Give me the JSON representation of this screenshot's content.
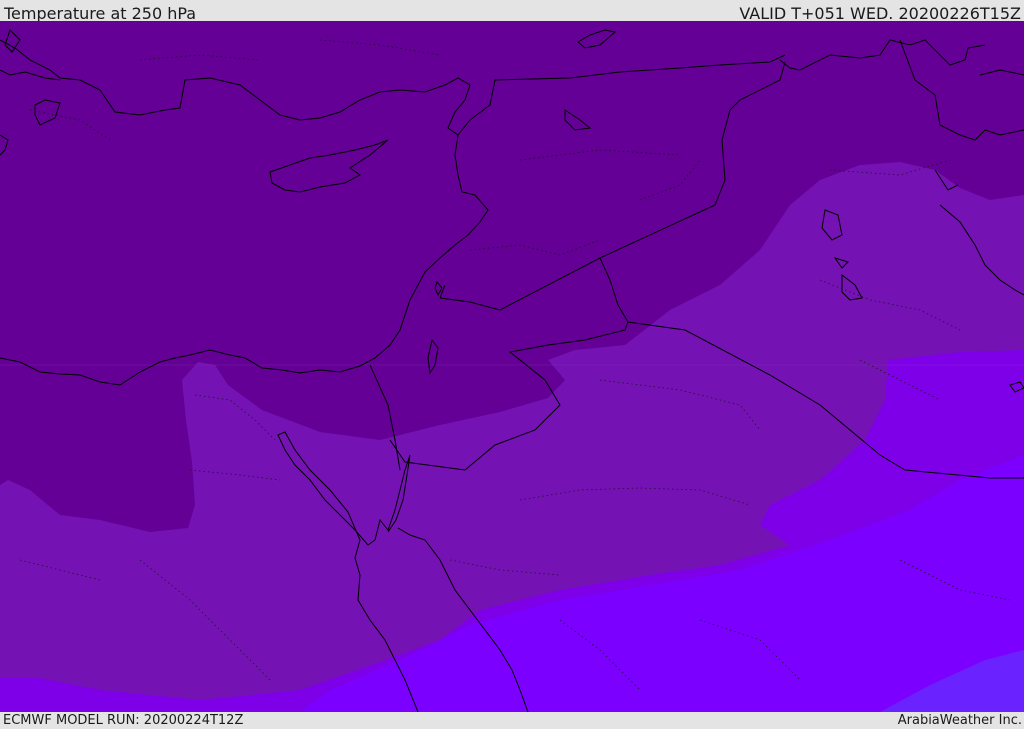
{
  "header": {
    "title": "Temperature at 250 hPa",
    "valid_time": "VALID T+051 WED. 20200226T15Z"
  },
  "footer": {
    "model_run": "ECMWF MODEL RUN: 20200224T12Z",
    "credit": "ArabiaWeather Inc."
  },
  "map": {
    "variable": "temperature",
    "level": "250 hPa",
    "colors": {
      "coldest": "#640095",
      "cold": "#7412b3",
      "mild": "#7d00e6",
      "warm": "#7b00ff",
      "warmest": "#6a1eff",
      "coastline": "#000000",
      "border": "#000000"
    }
  }
}
